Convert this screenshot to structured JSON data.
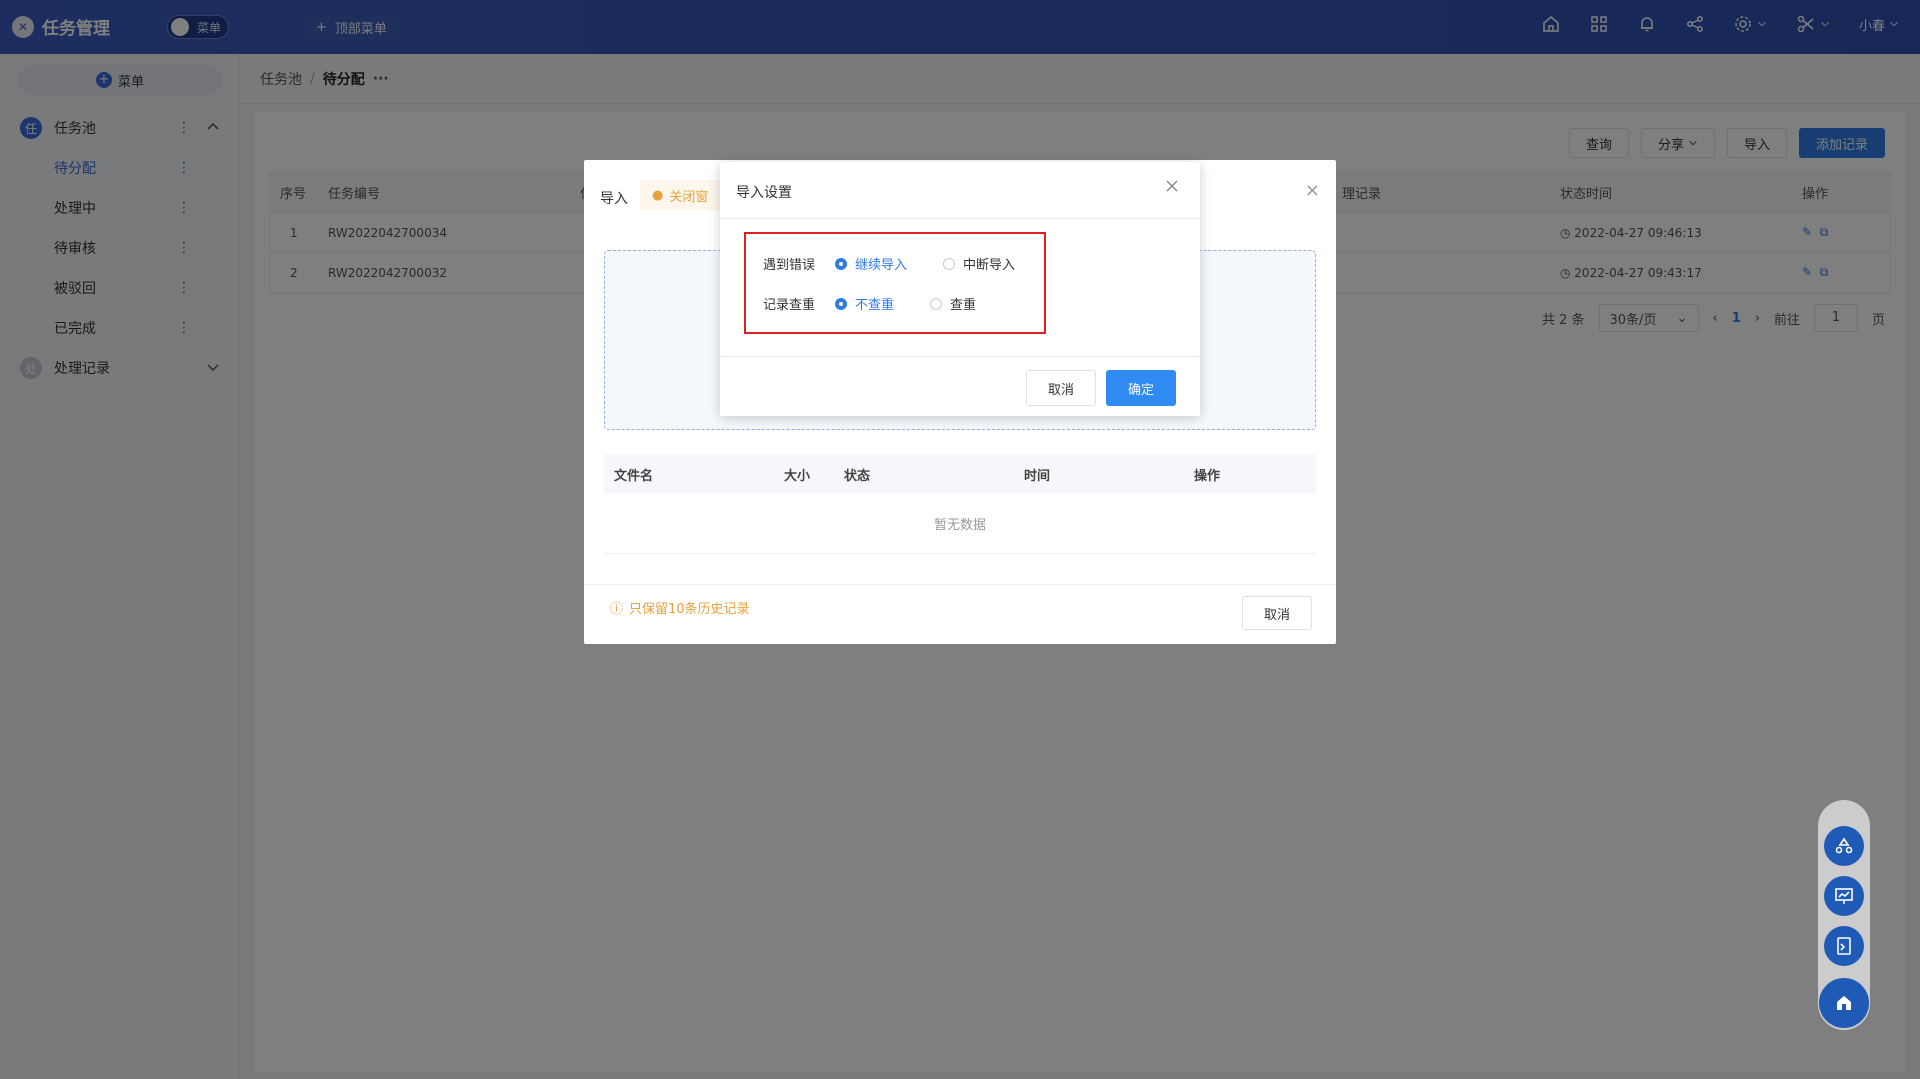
{
  "app": {
    "logo_char": "✕",
    "title": "任务管理"
  },
  "header": {
    "toggle_label": "菜单",
    "top_menu_label": "顶部菜单",
    "user_name": "小春"
  },
  "sidebar": {
    "menu_button": "菜单",
    "groups": [
      {
        "badge": "任",
        "label": "任务池"
      },
      {
        "badge": "处",
        "label": "处理记录"
      }
    ],
    "items": [
      {
        "label": "待分配"
      },
      {
        "label": "处理中"
      },
      {
        "label": "待审核"
      },
      {
        "label": "被驳回"
      },
      {
        "label": "已完成"
      }
    ]
  },
  "breadcrumb": {
    "root": "任务池",
    "sep": "/",
    "current": "待分配",
    "more": "···"
  },
  "toolbar": {
    "query": "查询",
    "share": "分享",
    "import": "导入",
    "add": "添加记录"
  },
  "table": {
    "headers": [
      "序号",
      "任务编号",
      "任",
      "理记录",
      "状态时间",
      "操作"
    ],
    "rows": [
      {
        "index": "1",
        "task_no": "RW2022042700034",
        "status_time": "2022-04-27 09:46:13"
      },
      {
        "index": "2",
        "task_no": "RW2022042700032",
        "status_time": "2022-04-27 09:43:17"
      }
    ]
  },
  "pager": {
    "total": "共 2 条",
    "page_size": "30条/页",
    "current": "1",
    "goto_label": "前往",
    "goto_value": "1",
    "page_unit": "页"
  },
  "import_dialog": {
    "title": "导入",
    "warning": "关闭窗",
    "file_headers": [
      "文件名",
      "大小",
      "状态",
      "时间",
      "操作"
    ],
    "empty_text": "暂无数据",
    "note": "只保留10条历史记录",
    "cancel": "取消"
  },
  "settings_dialog": {
    "title": "导入设置",
    "rows": [
      {
        "label": "遇到错误",
        "options": [
          "继续导入",
          "中断导入"
        ],
        "selected": 0
      },
      {
        "label": "记录查重",
        "options": [
          "不查重",
          "查重"
        ],
        "selected": 0
      }
    ],
    "cancel": "取消",
    "confirm": "确定"
  },
  "colors": {
    "header": "#3a5bbf",
    "primary": "#2f7ae5",
    "highlight": "#e02020",
    "warning": "#e6a23c"
  }
}
